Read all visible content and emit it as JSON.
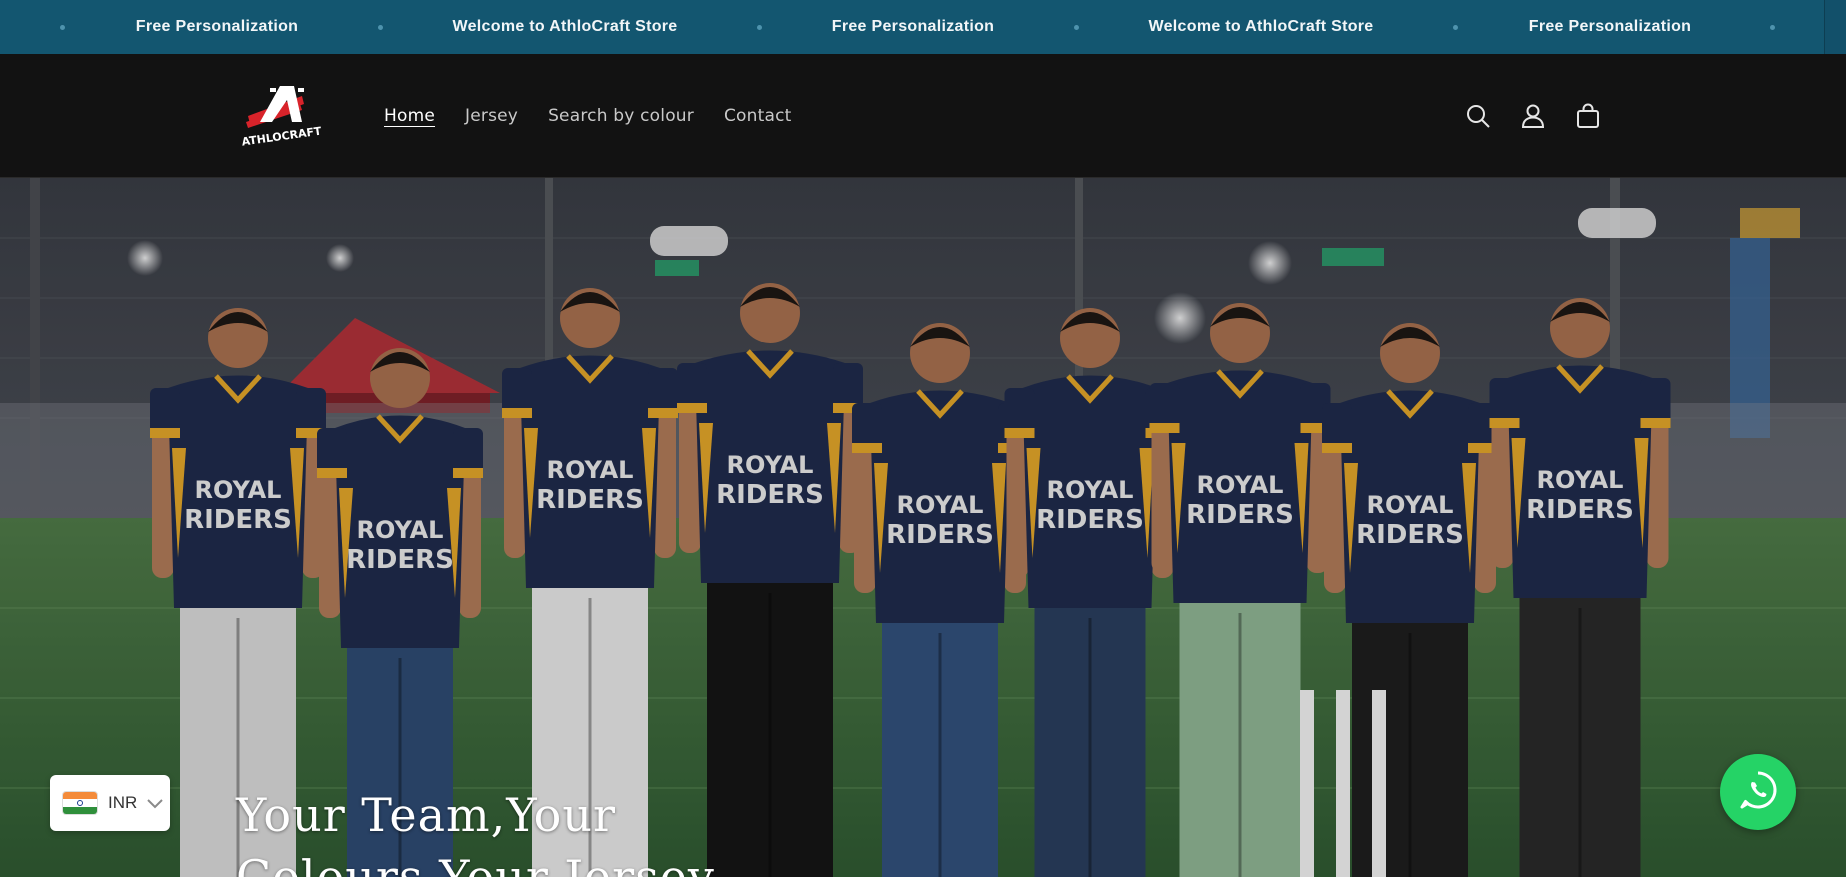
{
  "announcement": {
    "items": [
      "Free Personalization",
      "Welcome to AthloCraft Store",
      "Free Personalization",
      "Welcome to AthloCraft Store",
      "Free Personalization"
    ]
  },
  "header": {
    "logo_text": "ATHLOCRAFT",
    "nav": [
      {
        "label": "Home",
        "active": true
      },
      {
        "label": "Jersey",
        "active": false
      },
      {
        "label": "Search by colour",
        "active": false
      },
      {
        "label": "Contact",
        "active": false
      }
    ],
    "icons": [
      "search-icon",
      "account-icon",
      "cart-icon"
    ]
  },
  "hero": {
    "title": "Your Team,Your Colours,Your Jersey",
    "jersey_text_line1": "ROYAL",
    "jersey_text_line2": "RIDERS"
  },
  "currency": {
    "code": "INR",
    "flag": "india-flag-icon"
  },
  "whatsapp": {
    "icon": "whatsapp-icon"
  },
  "colors": {
    "announcement_bg": "#135670",
    "header_bg": "#121212",
    "jersey_navy": "#1f2b4c",
    "jersey_gold": "#e2a52a",
    "whatsapp_green": "#25d366"
  }
}
